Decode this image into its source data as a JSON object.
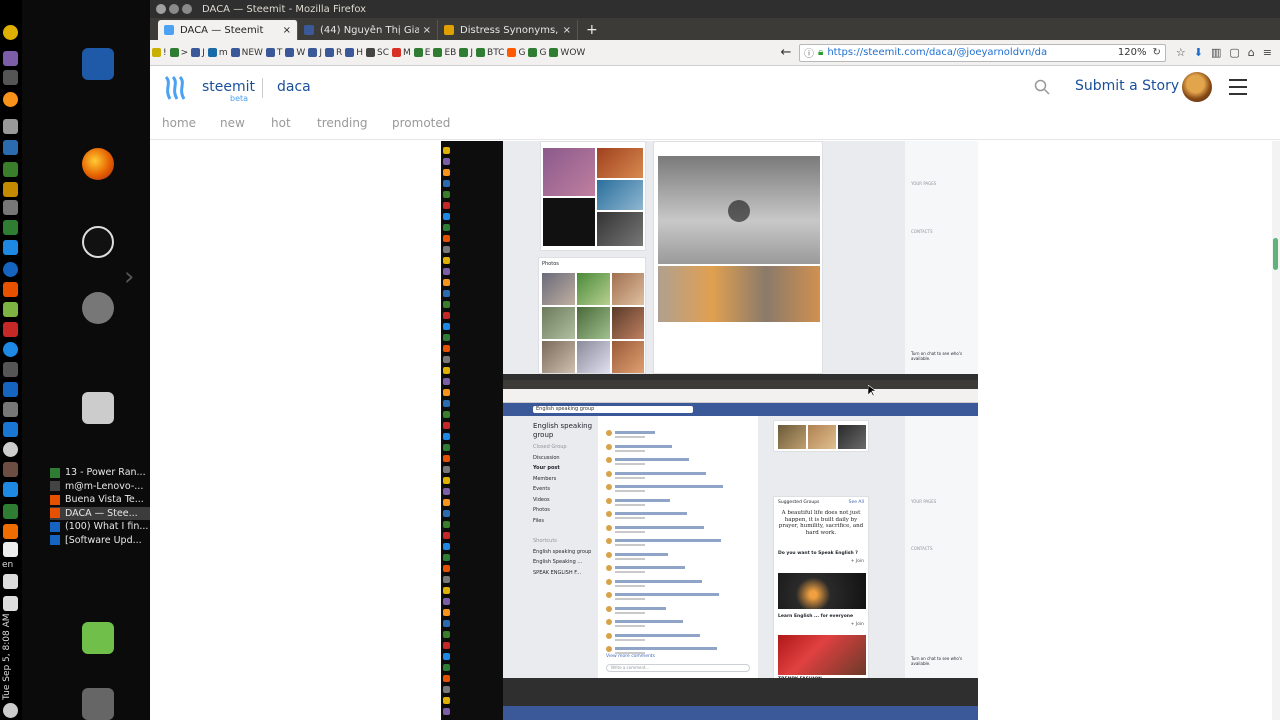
{
  "window": {
    "title": "DACA — Steemit - Mozilla Firefox"
  },
  "tabs": [
    {
      "label": "DACA — Steemit",
      "active": true
    },
    {
      "label": "(44) Nguyễn Thị Giang",
      "active": false
    },
    {
      "label": "Distress Synonyms, Di",
      "active": false
    }
  ],
  "bookmarks": [
    {
      "label": "!",
      "color": "#c8b000"
    },
    {
      "label": ">",
      "color": "#2e7d32"
    },
    {
      "label": "J",
      "color": "#3b5998"
    },
    {
      "label": "m",
      "color": "#1a6aa8"
    },
    {
      "label": "NEW",
      "color": "#3b5998"
    },
    {
      "label": "T",
      "color": "#3b5998"
    },
    {
      "label": "W",
      "color": "#3b5998"
    },
    {
      "label": "J",
      "color": "#3b5998"
    },
    {
      "label": "R",
      "color": "#3b5998"
    },
    {
      "label": "H",
      "color": "#3b5998"
    },
    {
      "label": "SC",
      "color": "#444444"
    },
    {
      "label": "M",
      "color": "#d93025"
    },
    {
      "label": "E",
      "color": "#2e7d32"
    },
    {
      "label": "EB",
      "color": "#2e7d32"
    },
    {
      "label": "J",
      "color": "#2e7d32"
    },
    {
      "label": "BTC",
      "color": "#2e7d32"
    },
    {
      "label": "G",
      "color": "#ff5a00"
    },
    {
      "label": "G",
      "color": "#2e7d32"
    },
    {
      "label": "WOW",
      "color": "#2e7d32"
    }
  ],
  "url": {
    "value": "https://steemit.com/daca/@joeyarnoldvn/da",
    "zoom": "120%"
  },
  "site": {
    "brand": "steemit",
    "beta": "beta",
    "community": "daca",
    "submit_label": "Submit a Story"
  },
  "subnav": [
    {
      "label": "home"
    },
    {
      "label": "new"
    },
    {
      "label": "hot"
    },
    {
      "label": "trending"
    },
    {
      "label": "promoted"
    }
  ],
  "launcher": {
    "tray": {
      "lang": "en",
      "clock": "Tue Sep 5, 8:08 AM"
    },
    "windows": [
      {
        "label": "13 - Power Ran...",
        "color": "#2e7d32",
        "active": false
      },
      {
        "label": "m@m-Lenovo-...",
        "color": "#444444",
        "active": false
      },
      {
        "label": "Buena Vista Te...",
        "color": "#e65100",
        "active": false
      },
      {
        "label": "DACA — Stee...",
        "color": "#e65100",
        "active": true
      },
      {
        "label": "(100) What I fin...",
        "color": "#1565c0",
        "active": false
      },
      {
        "label": "[Software Upd...",
        "color": "#1565c0",
        "active": false
      }
    ]
  },
  "embedded_screenshot": {
    "group_name": "English speaking group",
    "group_type": "Closed Group",
    "search_placeholder": "English speaking group",
    "left_menu": [
      "Discussion",
      "Your post",
      "Members",
      "Events",
      "Videos",
      "Photos",
      "Files"
    ],
    "shortcuts_title": "Shortcuts",
    "shortcuts": [
      "English speaking group",
      "English Speaking ...",
      "SPEAK ENGLISH F..."
    ],
    "photos_label": "Photos",
    "suggested_groups": "Suggested Groups",
    "see_all": "See All",
    "quote": "A beautiful life does not just happen, it is built daily by prayer, humility, sacrifice, and hard work.",
    "sugg_1": "Do you want to Speak English ?",
    "sugg_2": "Learn English ... for everyone",
    "sugg_3": "TRENDY FASHION",
    "join": "+ Join",
    "view_more": "View more comments",
    "write_comment": "Write a comment...",
    "your_pages": "YOUR PAGES",
    "contacts": "CONTACTS",
    "turn_on_chat": "Turn on chat to see who's available."
  },
  "colors": {
    "steemit_blue": "#1a5099",
    "steemit_light": "#4ba2f2",
    "facebook_blue": "#3b5998",
    "ubuntu_tabbar": "#3c3b37"
  }
}
